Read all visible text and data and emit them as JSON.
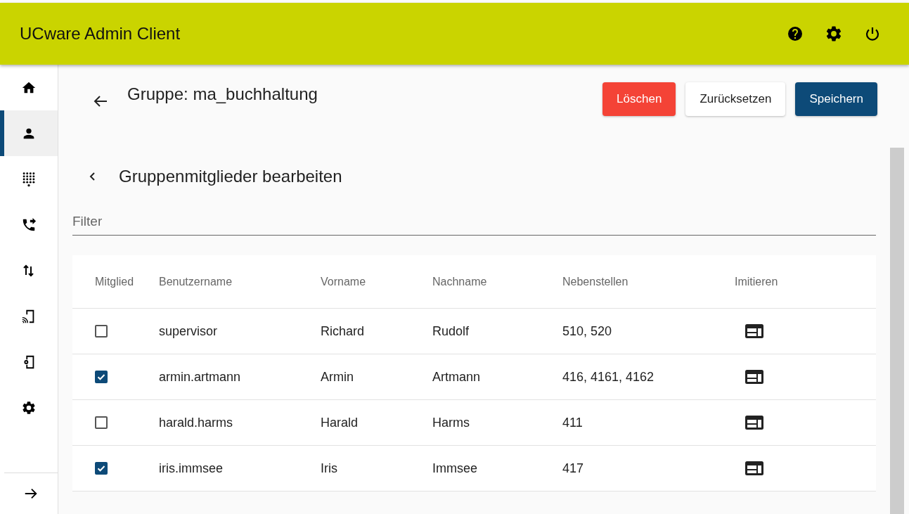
{
  "app_title": "UCware Admin Client",
  "sidebar": {
    "items": [
      {
        "kind": "home",
        "selected": false
      },
      {
        "kind": "user",
        "selected": true
      },
      {
        "kind": "dialpad",
        "selected": false
      },
      {
        "kind": "forward",
        "selected": false
      },
      {
        "kind": "swap",
        "selected": false
      },
      {
        "kind": "cast",
        "selected": false
      },
      {
        "kind": "device",
        "selected": false
      },
      {
        "kind": "settings",
        "selected": false
      }
    ]
  },
  "page_title": "Gruppe: ma_buchhaltung",
  "buttons": [
    {
      "label": "Löschen",
      "kind": "danger"
    },
    {
      "label": "Zurücksetzen",
      "kind": "plain"
    },
    {
      "label": "Speichern",
      "kind": "primary"
    }
  ],
  "section_title": "Gruppenmitglieder bearbeiten",
  "filter": {
    "placeholder": "Filter"
  },
  "table": {
    "columns": [
      "Mitglied",
      "Benutzername",
      "Vorname",
      "Nachname",
      "Nebenstellen",
      "Imitieren"
    ],
    "rows": [
      {
        "checked": false,
        "username": "supervisor",
        "first": "Richard",
        "last": "Rudolf",
        "extensions": "510, 520"
      },
      {
        "checked": true,
        "username": "armin.artmann",
        "first": "Armin",
        "last": "Artmann",
        "extensions": "416, 4161, 4162"
      },
      {
        "checked": false,
        "username": "harald.harms",
        "first": "Harald",
        "last": "Harms",
        "extensions": "411"
      },
      {
        "checked": true,
        "username": "iris.immsee",
        "first": "Iris",
        "last": "Immsee",
        "extensions": "417"
      }
    ]
  }
}
